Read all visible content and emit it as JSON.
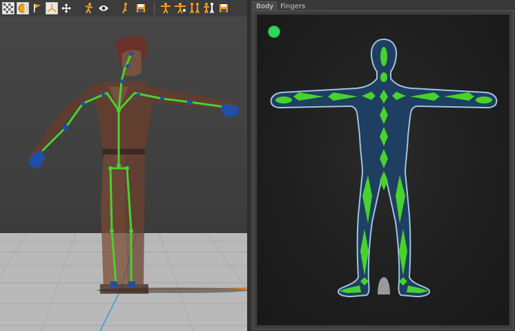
{
  "toolbar": {
    "icons": [
      "checker-icon",
      "sphere-icon",
      "flag-icon",
      "axis-icon",
      "move-icon",
      "pose-icon",
      "eye-icon",
      "pose-save-icon",
      "mirror-pose-icon",
      "tpose-icon",
      "reset-pose-icon",
      "enforce-tpose-icon",
      "save-pose-icon"
    ],
    "active": [
      "checker-icon",
      "sphere-icon",
      "axis-icon"
    ]
  },
  "inspector": {
    "tabs": [
      {
        "label": "Body",
        "active": true
      },
      {
        "label": "Fingers",
        "active": false
      }
    ],
    "status": "mapped"
  },
  "colors": {
    "bone_green": "#48d32c",
    "bone_blue": "#1f4fa8",
    "body_fill": "#1e3f62",
    "body_outline": "#9fc6e0",
    "status_green": "#2fd65b",
    "optional_gray": "#9a9a9a"
  }
}
